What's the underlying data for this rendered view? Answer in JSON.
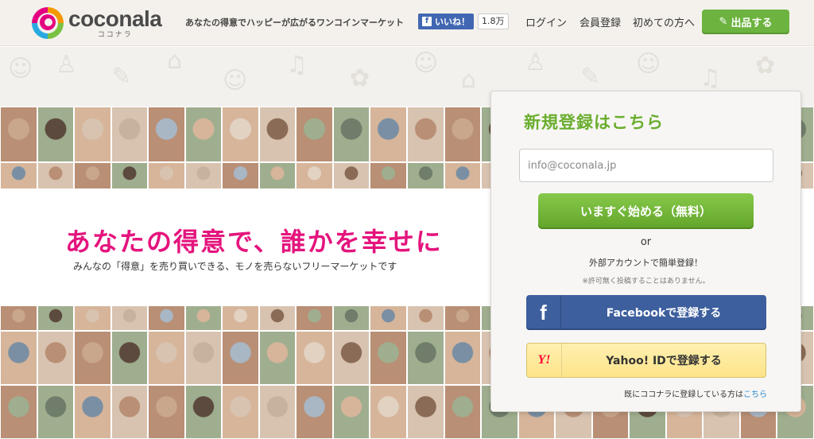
{
  "header": {
    "logo_name": "coconala",
    "logo_kana": "ココナラ",
    "tagline": "あなたの得意でハッピーが広がるワンコインマーケット",
    "fb_like_label": "いいね！",
    "fb_like_count": "1.8万",
    "nav": [
      "ログイン",
      "会員登録",
      "初めての方へ"
    ],
    "sell_button": "出品する"
  },
  "hero": {
    "headline": "あなたの得意で、誰かを幸せに",
    "subline": "みんなの「得意」を売り買いできる、モノを売らないフリーマーケットです"
  },
  "signup": {
    "title": "新規登録はこちら",
    "email_placeholder": "info@coconala.jp",
    "start_button": "いますぐ始める（無料）",
    "or_text": "or",
    "external_text": "外部アカウントで簡単登録！",
    "note": "※許可無く投稿することはありません。",
    "facebook_button": "Facebookで登録する",
    "yahoo_button": "Yahoo! IDで登録する",
    "login_prompt": "既にココナラに登録している方は",
    "login_link": "こちら"
  },
  "colors": {
    "brand_green": "#6db33f",
    "brand_pink": "#e4147d",
    "facebook_blue": "#3d5f9e",
    "yahoo_yellow": "#fde48a"
  },
  "icons": [
    "facebook-icon",
    "yahoo-icon",
    "pencil-icon"
  ]
}
